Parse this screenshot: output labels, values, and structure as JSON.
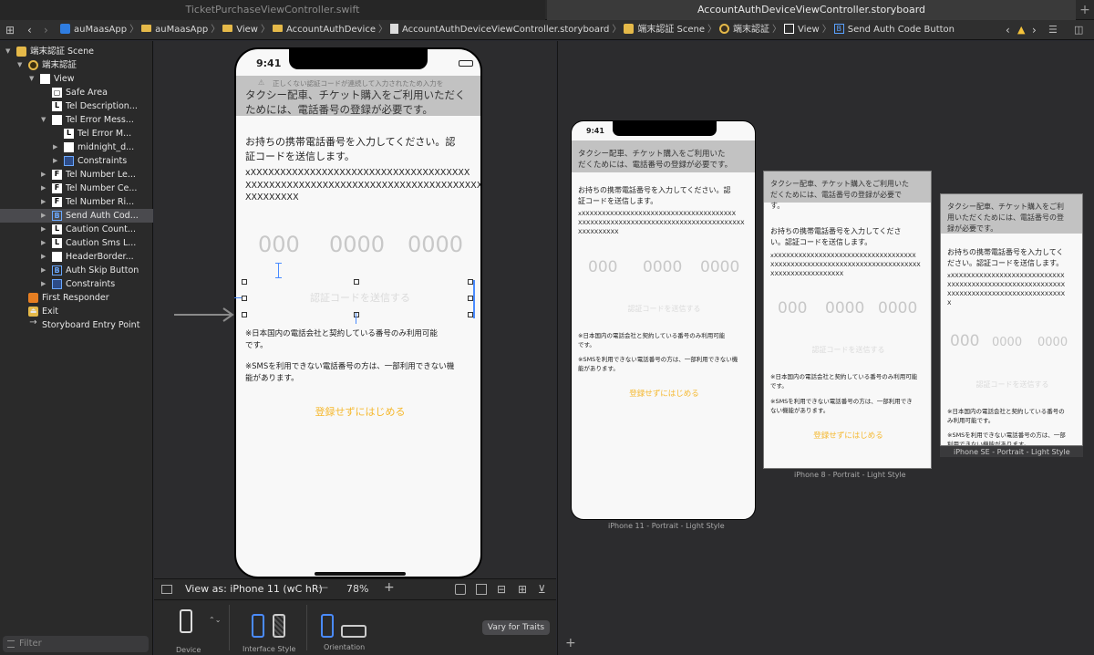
{
  "tabs": {
    "left": "TicketPurchaseViewController.swift",
    "right": "AccountAuthDeviceViewController.storyboard",
    "plus": "+"
  },
  "breadcrumb": [
    "auMaasApp",
    "auMaasApp",
    "View",
    "AccountAuthDevice",
    "AccountAuthDeviceViewController.storyboard",
    "端末認証 Scene",
    "端末認証",
    "View",
    "Send Auth Code Button"
  ],
  "outline": [
    {
      "label": "端末認証 Scene",
      "icon": "scene-icon",
      "level": 0,
      "open": true
    },
    {
      "label": "端末認証",
      "icon": "view-controller-icon",
      "level": 1,
      "open": true
    },
    {
      "label": "View",
      "icon": "view-icon",
      "level": 2,
      "open": true
    },
    {
      "label": "Safe Area",
      "icon": "safe-area-icon",
      "level": 3
    },
    {
      "label": "Tel Description...",
      "icon": "label-icon",
      "level": 3
    },
    {
      "label": "Tel Error Mess...",
      "icon": "view-icon",
      "level": 3,
      "open": true
    },
    {
      "label": "Tel Error M...",
      "icon": "label-icon",
      "level": 4
    },
    {
      "label": "midnight_d...",
      "icon": "image-icon",
      "level": 4,
      "closed": true
    },
    {
      "label": "Constraints",
      "icon": "constraints-icon",
      "level": 4,
      "closed": true
    },
    {
      "label": "Tel Number Le...",
      "icon": "text-field-icon",
      "level": 3,
      "closed": true
    },
    {
      "label": "Tel Number Ce...",
      "icon": "text-field-icon",
      "level": 3,
      "closed": true
    },
    {
      "label": "Tel Number Ri...",
      "icon": "text-field-icon",
      "level": 3,
      "closed": true
    },
    {
      "label": "Send Auth Cod...",
      "icon": "button-icon",
      "level": 3,
      "closed": true,
      "selected": true
    },
    {
      "label": "Caution Count...",
      "icon": "label-icon",
      "level": 3,
      "closed": true
    },
    {
      "label": "Caution Sms L...",
      "icon": "label-icon",
      "level": 3,
      "closed": true
    },
    {
      "label": "HeaderBorder...",
      "icon": "view-icon",
      "level": 3,
      "closed": true
    },
    {
      "label": "Auth Skip Button",
      "icon": "button-icon",
      "level": 3,
      "closed": true
    },
    {
      "label": "Constraints",
      "icon": "constraints-icon",
      "level": 3,
      "closed": true
    },
    {
      "label": "First Responder",
      "icon": "first-responder-icon",
      "level": 1
    },
    {
      "label": "Exit",
      "icon": "exit-icon",
      "level": 1
    },
    {
      "label": "Storyboard Entry Point",
      "icon": "entry-arrow-icon",
      "level": 1
    }
  ],
  "filter_placeholder": "Filter",
  "phone": {
    "time": "9:41",
    "warning": "正しくない認証コードが連続して入力されたため入力を",
    "header": "タクシー配車、チケット購入をご利用いただく\nためには、電話番号の登録が必要です。",
    "instruction": "お持ちの携帯電話番号を入力してください。認\n証コードを送信します。",
    "error": "xXXXXXXXXXXXXXXXXXXXXXXXXXXXXXXXXXXXXX\nXXXXXXXXXXXXXXXXXXXXXXXXXXXXXXXXXXXXXXXX\nXXXXXXXXX",
    "tel": [
      "000",
      "0000",
      "0000"
    ],
    "send_button": "認証コードを送信する",
    "caution1": "※日本国内の電話会社と契約している番号のみ利用可能\nです。",
    "caution2": "※SMSを利用できない電話番号の方は、一部利用できない機\n能があります。",
    "skip": "登録せずにはじめる"
  },
  "preview": {
    "iphone11": "iPhone 11 - Portrait - Light Style",
    "iphone8": "iPhone 8 - Portrait - Light Style",
    "iphonese": "iPhone SE - Portrait - Light Style",
    "p11_header": "タクシー配車、チケット購入をご利用いた\nだくためには、電話番号の登録が必要です。",
    "p11_instr": "お持ちの携帯電話番号を入力してください。認\n証コードを送信します。",
    "p11_err": "xXXXXXXXXXXXXXXXXXXXXXXXXXXXXXXXXXXXXXX\nXXXXXXXXXXXXXXXXXXXXXXXXXXXXXXXXXXXXXXXXX\nXXXXXXXXXX",
    "p8_header": "タクシー配車、チケット購入をご利用いた\nだくためには、電話番号の登録が必要で\nす。",
    "p8_instr": "お持ちの携帯電話番号を入力してくださ\nい。認証コードを送信します。",
    "p8_err": "xXXXXXXXXXXXXXXXXXXXXXXXXXXXXXXXXXXX\nXXXXXXXXXXXXXXXXXXXXXXXXXXXXXXXXXXXXX\nXXXXXXXXXXXXXXXXXX",
    "p8_c1": "※日本国内の電話会社と契約している番号のみ利用可能\nです。",
    "p8_c2": "※SMSを利用できない電話番号の方は、一部利用でき\nない機能があります。",
    "se_header": "タクシー配車、チケット購入をご利\n用いただくためには、電話番号の登\n録が必要です。",
    "se_instr": "お持ちの携帯電話番号を入力してく\nださい。認証コードを送信します。",
    "se_err": "xXXXXXXXXXXXXXXXXXXXXXXXXXXXX\nXXXXXXXXXXXXXXXXXXXXXXXXXXXXX\nXXXXXXXXXXXXXXXXXXXXXXXXXXXXX\nX",
    "se_c1": "※日本国内の電話会社と契約している番号の\nみ利用可能です。",
    "se_c2": "※SMSを利用できない電話番号の方は、一部\n利用できない機能があります。"
  },
  "toolbar": {
    "view_as": "View as: iPhone 11 (wC hR)",
    "zoom": "78%",
    "minus": "—",
    "plus": "+"
  },
  "config": {
    "device": "Device",
    "interface": "Interface Style",
    "orientation": "Orientation",
    "vary": "Vary for Traits"
  },
  "colors": {
    "accent": "#f5b82e",
    "selection": "#4a4a4e",
    "blue": "#4a8bff"
  }
}
